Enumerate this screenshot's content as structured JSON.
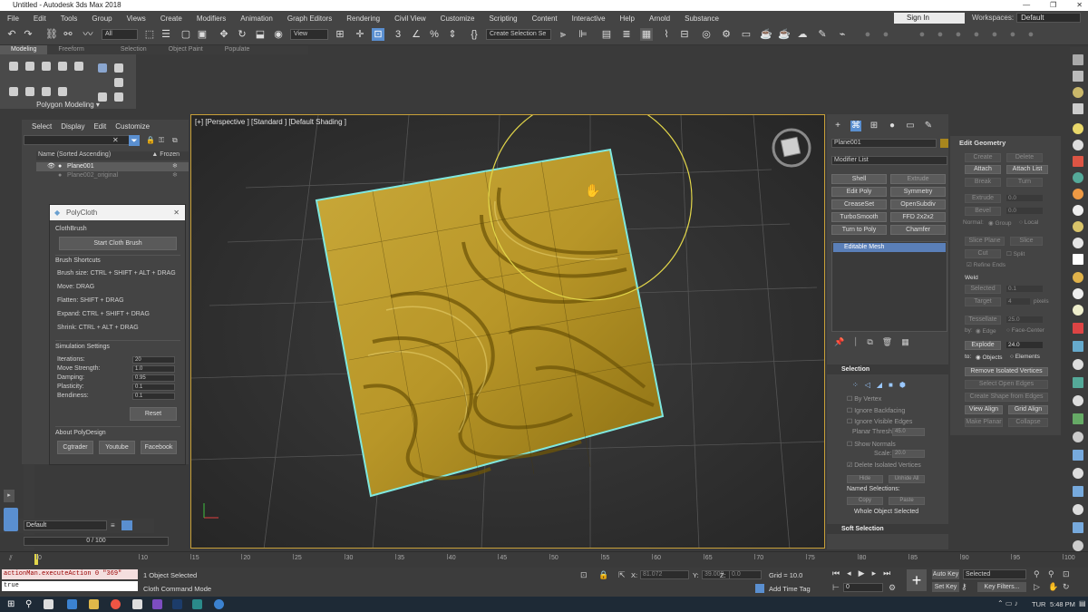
{
  "window": {
    "title": "Untitled - Autodesk 3ds Max 2018",
    "controls": [
      "—",
      "❐",
      "✕"
    ]
  },
  "menu": [
    "File",
    "Edit",
    "Tools",
    "Group",
    "Views",
    "Create",
    "Modifiers",
    "Animation",
    "Graph Editors",
    "Rendering",
    "Civil View",
    "Customize",
    "Scripting",
    "Content",
    "Interactive",
    "Help",
    "Arnold",
    "Substance"
  ],
  "account": {
    "signin": "Sign In",
    "workspaces_label": "Workspaces:",
    "workspace": "Default"
  },
  "toolbar": {
    "filter": "All",
    "refcoord": "View",
    "selset": "Create Selection Se"
  },
  "ribbon": {
    "tabs": [
      "Modeling",
      "Freeform",
      "Selection",
      "Object Paint",
      "Populate"
    ],
    "active": "Modeling",
    "panel": "Polygon Modeling ▾"
  },
  "scene_explorer": {
    "menu": [
      "Select",
      "Display",
      "Edit",
      "Customize"
    ],
    "col_name": "Name (Sorted Ascending)",
    "col_frozen": "▲ Frozen",
    "rows": [
      {
        "name": "Plane001"
      },
      {
        "name": "Plane002_original"
      }
    ]
  },
  "polycloth": {
    "title": "PolyCloth",
    "close": "✕",
    "section_brush": "ClothBrush",
    "start_btn": "Start Cloth Brush",
    "section_shortcuts": "Brush Shortcuts",
    "shortcuts": [
      "Brush size: CTRL + SHIFT + ALT + DRAG",
      "Move: DRAG",
      "Flatten: SHIFT + DRAG",
      "Expand: CTRL + SHIFT + DRAG",
      "Shrink: CTRL + ALT + DRAG"
    ],
    "section_sim": "Simulation Settings",
    "settings": [
      {
        "label": "Iterations:",
        "value": "20"
      },
      {
        "label": "Move Strength:",
        "value": "1.0"
      },
      {
        "label": "Damping:",
        "value": "0.95"
      },
      {
        "label": "Plasticity:",
        "value": "0.1"
      },
      {
        "label": "Bendiness:",
        "value": "0.1"
      }
    ],
    "reset": "Reset",
    "section_about": "About PolyDesign",
    "links": [
      "Cgtrader",
      "Youtube",
      "Facebook"
    ]
  },
  "viewport": {
    "label": "[+] [Perspective ] [Standard ] [Default Shading ]"
  },
  "command_panel": {
    "object_name": "Plane001",
    "object_color": "#a8861e",
    "modifier_list": "Modifier List",
    "modifier_buttons": [
      "Shell",
      "Extrude",
      "Edit Poly",
      "Symmetry",
      "CreaseSet",
      "OpenSubdiv",
      "TurboSmooth",
      "FFD 2x2x2",
      "Turn to Poly",
      "Chamfer"
    ],
    "stack_item": "Editable Mesh",
    "selection": {
      "title": "Selection",
      "by_vertex": "By Vertex",
      "ignore_backfacing": "Ignore Backfacing",
      "ignore_visible": "Ignore Visible Edges",
      "planar_thresh": "Planar Thresh:",
      "planar_val": "45.0",
      "show_normals": "Show Normals",
      "scale": "Scale:",
      "scale_val": "20.0",
      "delete_isolated": "Delete Isolated Vertices",
      "hide": "Hide",
      "unhide": "Unhide All",
      "named": "Named Selections:",
      "copy": "Copy",
      "paste": "Paste",
      "whole": "Whole Object Selected"
    },
    "soft_selection": "Soft Selection"
  },
  "edit_geometry": {
    "title": "Edit Geometry",
    "btns": {
      "create": "Create",
      "delete": "Delete",
      "attach": "Attach",
      "attach_list": "Attach List",
      "break": "Break",
      "turn": "Turn"
    },
    "extrude": "Extrude",
    "extrude_val": "0.0",
    "bevel": "Bevel",
    "bevel_val": "0.0",
    "normal": "Normal:",
    "group": "Group",
    "local": "Local",
    "slice_plane": "Slice Plane",
    "slice": "Slice",
    "cut": "Cut",
    "split": "Split",
    "refine_ends": "Refine Ends",
    "weld": "Weld",
    "selected": "Selected",
    "selected_val": "0.1",
    "target": "Target",
    "target_val": "4",
    "pixels": "pixels",
    "tessellate": "Tessellate",
    "tess_val": "25.0",
    "by": "by:",
    "edge": "Edge",
    "face_center": "Face-Center",
    "explode": "Explode",
    "explode_val": "24.0",
    "to": "to:",
    "objects": "Objects",
    "elements": "Elements",
    "remove_isolated": "Remove Isolated Vertices",
    "select_open": "Select Open Edges",
    "create_shape": "Create Shape from Edges",
    "view_align": "View Align",
    "grid_align": "Grid Align",
    "make_planar": "Make Planar",
    "collapse": "Collapse"
  },
  "layer": {
    "name": "Default"
  },
  "time": {
    "slider": "0 / 100",
    "ticks": [
      "0",
      "10",
      "15",
      "20",
      "25",
      "30",
      "35",
      "40",
      "45",
      "50",
      "55",
      "60",
      "65",
      "70",
      "75",
      "80",
      "85",
      "90",
      "95",
      "100"
    ]
  },
  "status": {
    "maxscript_out": "actionMan.executeAction 0 \"369\"",
    "maxscript_in": "true",
    "selected": "1 Object Selected",
    "mode": "Cloth Command Mode",
    "x": "X:",
    "x_val": "81.072",
    "y": "Y:",
    "y_val": "39.008",
    "z": "Z:",
    "z_val": "0.0",
    "grid": "Grid = 10.0",
    "add_time_tag": "Add Time Tag",
    "auto_key": "Auto Key",
    "set_key": "Set Key",
    "key_sel": "Selected",
    "key_filters": "Key Filters...",
    "frame": "0"
  },
  "taskbar": {
    "lang": "TUR",
    "time": "5:48 PM"
  }
}
